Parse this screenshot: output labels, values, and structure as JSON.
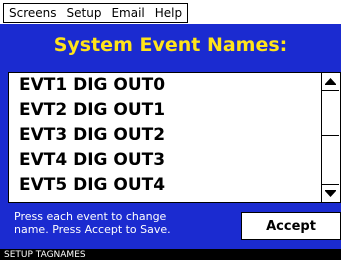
{
  "menu": {
    "items": [
      {
        "label": "Screens"
      },
      {
        "label": "Setup"
      },
      {
        "label": "Email"
      },
      {
        "label": "Help"
      }
    ]
  },
  "screen": {
    "title": "System Event Names:"
  },
  "event_list": {
    "items": [
      {
        "label": "EVT1 DIG OUT0"
      },
      {
        "label": "EVT2 DIG OUT1"
      },
      {
        "label": "EVT3 DIG OUT2"
      },
      {
        "label": "EVT4 DIG OUT3"
      },
      {
        "label": "EVT5 DIG OUT4"
      }
    ]
  },
  "instructions": {
    "line1": "Press each event to change",
    "line2": "name. Press Accept to Save."
  },
  "buttons": {
    "accept": "Accept"
  },
  "status": {
    "text": "SETUP TAGNAMES"
  },
  "colors": {
    "panel_background": "#1b2bd0",
    "title_text": "#ffe41a"
  }
}
